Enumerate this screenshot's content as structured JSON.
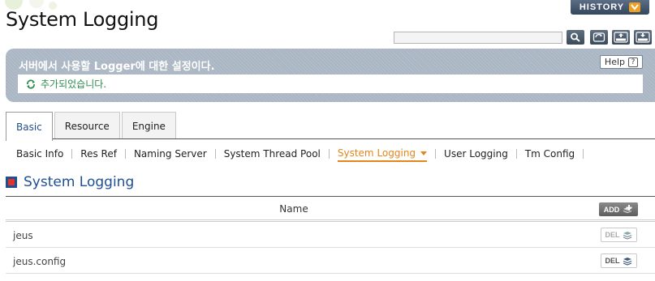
{
  "page": {
    "title": "System Logging"
  },
  "header": {
    "history_label": "HISTORY",
    "search": {
      "value": "",
      "placeholder": ""
    },
    "tools": [
      {
        "icon": "search-icon"
      },
      {
        "icon": "refresh-icon"
      },
      {
        "icon": "xml-export-icon"
      },
      {
        "icon": "xml-download-icon"
      }
    ]
  },
  "info_box": {
    "title": "서버에서 사용할 Logger에 대한 설정이다.",
    "help_label": "Help",
    "help_icon": "question-icon",
    "message": "추가되었습니다.",
    "message_icon": "refresh-green-icon",
    "message_color": "#2e8d4d"
  },
  "main_tabs": [
    {
      "label": "Basic",
      "active": true
    },
    {
      "label": "Resource",
      "active": false
    },
    {
      "label": "Engine",
      "active": false
    }
  ],
  "sub_tabs": [
    {
      "label": "Basic Info",
      "active": false
    },
    {
      "label": "Res Ref",
      "active": false
    },
    {
      "label": "Naming Server",
      "active": false
    },
    {
      "label": "System Thread Pool",
      "active": false
    },
    {
      "label": "System Logging",
      "active": true
    },
    {
      "label": "User Logging",
      "active": false
    },
    {
      "label": "Tm Config",
      "active": false
    }
  ],
  "section": {
    "title": "System Logging"
  },
  "table": {
    "column_name": "Name",
    "add_label": "ADD",
    "rows": [
      {
        "name": "jeus",
        "del_label": "DEL"
      },
      {
        "name": "jeus.config",
        "del_label": "DEL"
      }
    ]
  },
  "colors": {
    "accent_orange": "#e3861b",
    "heading_blue": "#1d4f94",
    "info_bg": "#aab6c3"
  }
}
